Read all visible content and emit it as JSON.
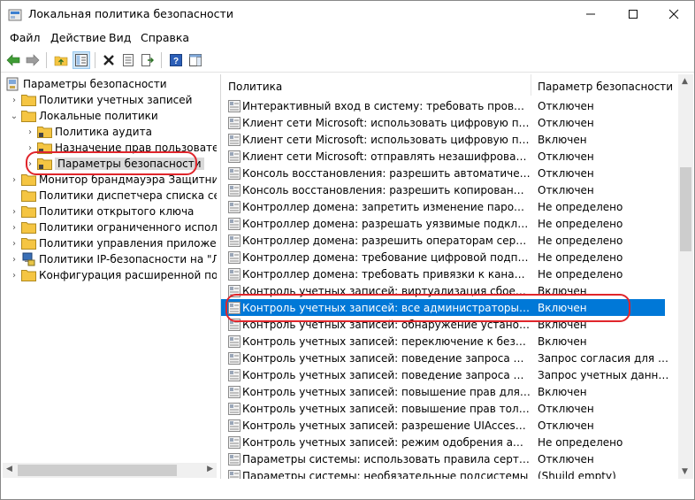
{
  "window": {
    "title": "Локальная политика безопасности",
    "controls": {
      "minimize": "—",
      "maximize": "☐",
      "close": "✕"
    }
  },
  "menu": [
    "Файл",
    "Действие",
    "Вид",
    "Справка"
  ],
  "toolbar": {
    "icons": [
      "back-arrow-icon",
      "forward-arrow-icon",
      "up-folder-icon",
      "show-hide-tree-icon",
      "delete-icon",
      "properties-icon",
      "export-list-icon",
      "help-icon",
      "console-pane-icon"
    ]
  },
  "tree": {
    "root": "Параметры безопасности",
    "items": [
      {
        "label": "Политики учетных записей"
      },
      {
        "label": "Локальные политики"
      },
      {
        "label": "Политика аудита"
      },
      {
        "label": "Назначение прав пользователя"
      },
      {
        "label": "Параметры безопасности"
      },
      {
        "label": "Монитор брандмауэра Защитника Windows"
      },
      {
        "label": "Политики диспетчера списка сетей"
      },
      {
        "label": "Политики открытого ключа"
      },
      {
        "label": "Политики ограниченного использования программ"
      },
      {
        "label": "Политики управления приложениями"
      },
      {
        "label": "Политики IP-безопасности на \"Локальный компьютер\""
      },
      {
        "label": "Конфигурация расширенной политики аудита"
      }
    ]
  },
  "list": {
    "columns": {
      "policy": "Политика",
      "setting": "Параметр безопасности"
    },
    "rows": [
      {
        "name": "Интерактивный вход в систему: требовать проверки на к...",
        "value": "Отключен"
      },
      {
        "name": "Клиент сети Microsoft: использовать цифровую подпись ...",
        "value": "Отключен"
      },
      {
        "name": "Клиент сети Microsoft: использовать цифровую подпись ...",
        "value": "Включен"
      },
      {
        "name": "Клиент сети Microsoft: отправлять незашифрованный па...",
        "value": "Отключен"
      },
      {
        "name": "Консоль восстановления: разрешить автоматический вх...",
        "value": "Отключен"
      },
      {
        "name": "Консоль восстановления: разрешить копирование диске...",
        "value": "Отключен"
      },
      {
        "name": "Контроллер домена: запретить изменение пароля учетн...",
        "value": "Не определено"
      },
      {
        "name": "Контроллер домена: разрешать уязвимые подключения ...",
        "value": "Не определено"
      },
      {
        "name": "Контроллер домена: разрешить операторам сервера зад...",
        "value": "Не определено"
      },
      {
        "name": "Контроллер домена: требование цифровой подписи для ...",
        "value": "Не определено"
      },
      {
        "name": "Контроллер домена: требовать привязки к каналу LDAP...",
        "value": "Не определено"
      },
      {
        "name": "Контроль учетных записей: виртуализация сбоев записи...",
        "value": "Включен"
      },
      {
        "name": "Контроль учетных записей: все администраторы работа...",
        "value": "Включен"
      },
      {
        "name": "Контроль учетных записей: обнаружение установки при...",
        "value": "Включен"
      },
      {
        "name": "Контроль учетных записей: переключение к безопасном...",
        "value": "Включен"
      },
      {
        "name": "Контроль учетных записей: поведение запроса на повы...",
        "value": "Запрос согласия для и..."
      },
      {
        "name": "Контроль учетных записей: поведение запроса на повы...",
        "value": "Запрос учетных данных"
      },
      {
        "name": "Контроль учетных записей: повышение прав для UIAcces...",
        "value": "Включен"
      },
      {
        "name": "Контроль учетных записей: повышение прав только для ...",
        "value": "Отключен"
      },
      {
        "name": "Контроль учетных записей: разрешение UIAccess-прило...",
        "value": "Отключен"
      },
      {
        "name": "Контроль учетных записей: режим одобрения админист...",
        "value": "Не определено"
      },
      {
        "name": "Параметры системы: использовать правила сертификат...",
        "value": "Отключен"
      },
      {
        "name": "Параметры системы: необязательные подсистемы",
        "value": "(Shuild empty)"
      }
    ],
    "selected_index": 12
  },
  "colors": {
    "selection": "#0078d7",
    "annotation": "#e0252b",
    "folder": "#f5c542"
  }
}
